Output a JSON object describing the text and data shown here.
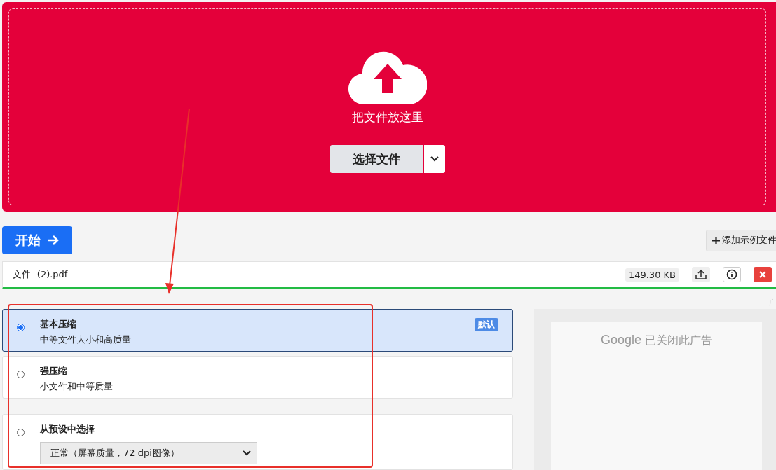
{
  "dropzone": {
    "label": "把文件放这里",
    "choose_button": "选择文件"
  },
  "toolbar": {
    "start_button": "开始",
    "sample_button": "添加示例文件"
  },
  "file": {
    "name": "文件- (2).pdf",
    "size": "149.30 KB"
  },
  "options": [
    {
      "kind": "plain",
      "title": "基本压缩",
      "subtitle": "中等文件大小和高质量",
      "badge": "默认",
      "selected": true
    },
    {
      "kind": "plain",
      "title": "强压缩",
      "subtitle": "小文件和中等质量",
      "selected": false
    },
    {
      "kind": "preset",
      "title": "从预设中选择",
      "value": "正常（屏幕质量，72 dpi图像）",
      "selected": false
    }
  ],
  "ad": {
    "label": "广",
    "brand": "Google",
    "message": "已关闭此广告"
  }
}
